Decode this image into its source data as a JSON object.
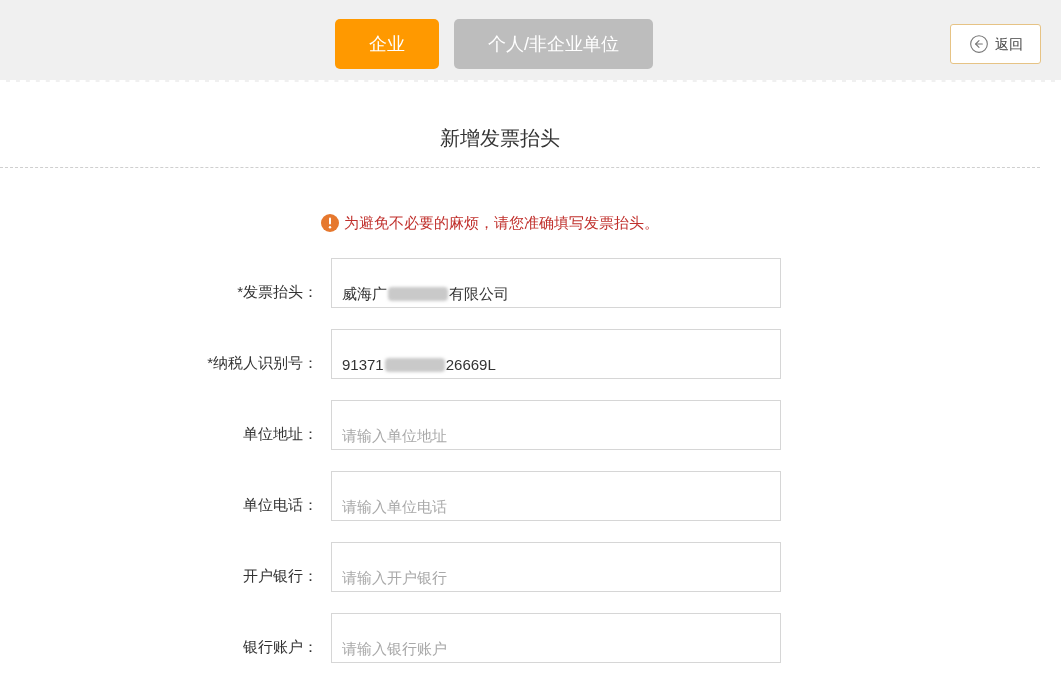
{
  "tabs": [
    {
      "label": "企业",
      "selected": true
    },
    {
      "label": "个人/非企业单位",
      "selected": false
    }
  ],
  "back_button": {
    "label": "返回"
  },
  "title": "新增发票抬头",
  "notice": "为避免不必要的麻烦，请您准确填写发票抬头。",
  "fields": [
    {
      "label": "*发票抬头：",
      "value": [
        {
          "kind": "text",
          "text": "威海广"
        },
        {
          "kind": "redacted"
        },
        {
          "kind": "text",
          "text": "有限公司"
        }
      ]
    },
    {
      "label": "*纳税人识别号：",
      "value": [
        {
          "kind": "text",
          "text": "91371"
        },
        {
          "kind": "redacted"
        },
        {
          "kind": "text",
          "text": "26669L"
        }
      ]
    },
    {
      "label": "单位地址：",
      "placeholder": "请输入单位地址"
    },
    {
      "label": "单位电话：",
      "placeholder": "请输入单位电话"
    },
    {
      "label": "开户银行：",
      "placeholder": "请输入开户银行"
    },
    {
      "label": "银行账户：",
      "placeholder": "请输入银行账户"
    }
  ]
}
